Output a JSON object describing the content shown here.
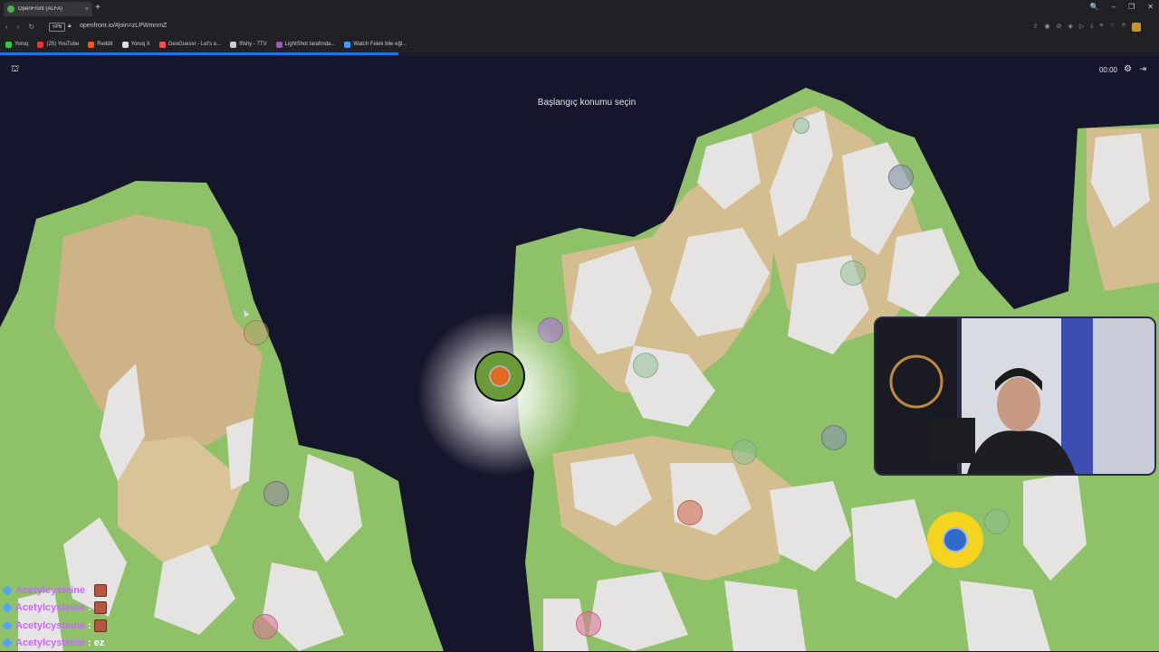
{
  "browser": {
    "tab_title": "OpenFront (ALFA)",
    "tab_close": "×",
    "new_tab": "+",
    "vpn": "VPN",
    "url": "openfront.io/#join=zLPWmnmZ",
    "window_controls": [
      "🔍",
      "–",
      "❐",
      "✕"
    ],
    "bookmarks": [
      {
        "label": "Yoruq",
        "color": "#2ecc40"
      },
      {
        "label": "(25) YouTube",
        "color": "#ff2d2d"
      },
      {
        "label": "Reddit",
        "color": "#ff5700"
      },
      {
        "label": "Yoruq X",
        "color": "#dddddd"
      },
      {
        "label": "GeoGuessr - Let's e...",
        "color": "#ff4d4d"
      },
      {
        "label": "Ifishy - 7TV",
        "color": "#cccccc"
      },
      {
        "label": "LightShot tarafında...",
        "color": "#9b59b6"
      },
      {
        "label": "Watch Felek bile eğl...",
        "color": "#3aa0ff"
      }
    ]
  },
  "game": {
    "hint": "Başlangıç konumu seçin",
    "timer": "00:00",
    "colors": {
      "water": "#15152b",
      "grass": "#8fc169",
      "sand": "#d4bd8f",
      "mountain": "#e6e4e2",
      "player": "#e06a1f"
    }
  },
  "chat": [
    {
      "user": "Acetylcysteine",
      "sep": ":",
      "emote": true,
      "message": ""
    },
    {
      "user": "Acetylcysteine",
      "sep": ":",
      "emote": true,
      "message": ""
    },
    {
      "user": "Acetylcysteine",
      "sep": ":",
      "emote": true,
      "message": ""
    },
    {
      "user": "Acetylcysteine",
      "sep": ":",
      "emote": false,
      "message": "ez"
    }
  ]
}
